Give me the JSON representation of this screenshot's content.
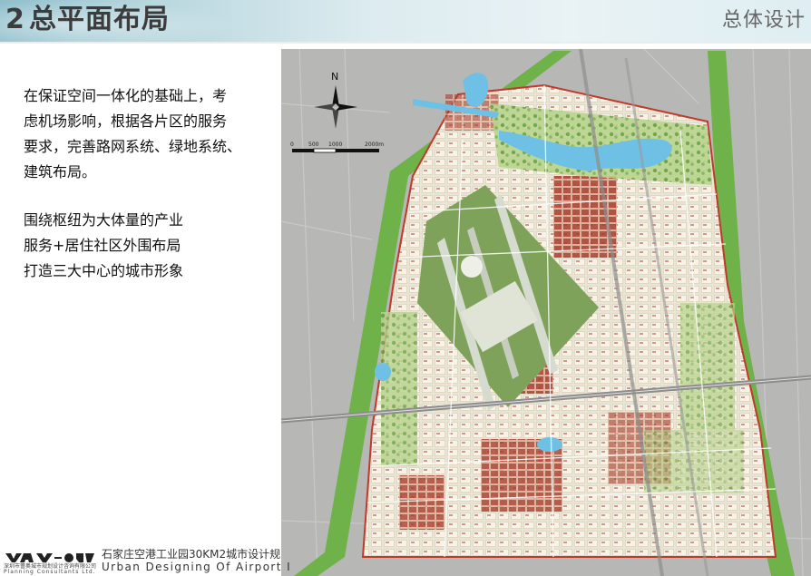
{
  "header": {
    "number": "2",
    "title": "总平面布局",
    "section": "总体设计"
  },
  "description": {
    "paragraph1": [
      "在保证空间一体化的基础上，考",
      "虑机场影响，根据各片区的服务",
      "要求，完善路网系统、绿地系统、",
      "建筑布局。"
    ],
    "paragraph2": [
      "围绕枢纽为大体量的产业",
      "服务+居住社区外围布局",
      "打造三大中心的城市形象"
    ]
  },
  "map": {
    "compass_label": "N",
    "scale_labels": [
      "0",
      "500",
      "1000",
      "2000m"
    ],
    "colors": {
      "background": "#b5b5b3",
      "green_belt": "#6fb24a",
      "airport": "#7ea25a",
      "residential": "#e8e3d3",
      "commercial": "#b04a3a",
      "water": "#6ec1e4",
      "boundary": "#c0392b"
    }
  },
  "footer": {
    "project_title": "石家庄空港工业园30KM2城市设计规",
    "project_title_en": "Urban  Designing  Of  Airport  I",
    "company_cn": "深圳市蕾奥城市规划设计咨询有限公司",
    "company_en": "Planning Consultants Ltd."
  }
}
